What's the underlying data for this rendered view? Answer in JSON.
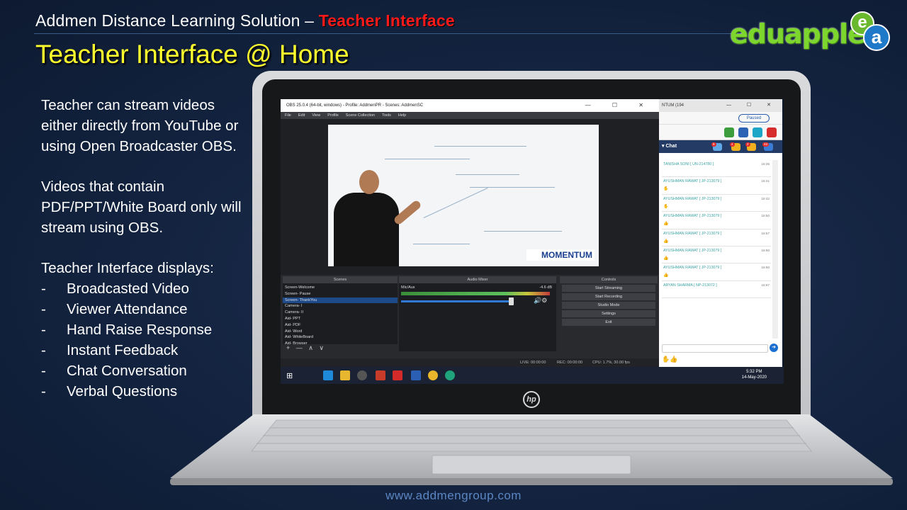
{
  "header": {
    "subtitle_main": "Addmen Distance Learning Solution – ",
    "subtitle_accent": "Teacher Interface",
    "title": "Teacher Interface @ Home",
    "logo_text": "eduapplet",
    "logo_mark_e": "e",
    "logo_mark_a": "a"
  },
  "content": {
    "para1": "Teacher can stream videos either directly from YouTube or using Open Broadcaster OBS.",
    "para2": "Videos that contain PDF/PPT/White Board only will stream using OBS.",
    "list_heading": "Teacher Interface displays:",
    "bullets": [
      "Broadcasted Video",
      "Viewer Attendance",
      "Hand Raise Response",
      "Instant Feedback",
      "Chat Conversation",
      "Verbal Questions"
    ],
    "bullet_marker": "-"
  },
  "footer": {
    "url": "www.addmengroup.com"
  },
  "laptop": {
    "brand": "hp"
  },
  "obs": {
    "title": "OBS 25.0.4 (64-bit, windows) - Profile: AddmenPR - Scenes: AddmenSC",
    "window_controls": "— ☐ ✕",
    "menu": [
      "File",
      "Edit",
      "View",
      "Profile",
      "Scene Collection",
      "Tools",
      "Help"
    ],
    "watermark": "MOMENTUM",
    "docks": {
      "scenes": "Scenes",
      "mixer": "Audio Mixer",
      "controls": "Controls"
    },
    "scenes": [
      "Screen-Welcome",
      "Screen- Pause",
      "Screen- ThankYou",
      "Camera- I",
      "Camera- II",
      "Aid- PPT",
      "Aid- PDF",
      "Aid- Word",
      "Aid- WhiteBoard",
      "Aid- Browser"
    ],
    "active_scene_index": 2,
    "scene_tools": "+ — ∧ ∨",
    "mixer": {
      "source": "Mic/Aux",
      "db": "-4.6 dB",
      "volume_fraction": 0.86
    },
    "controls": [
      "Start Streaming",
      "Start Recording",
      "Studio Mode",
      "Settings",
      "Exit"
    ],
    "status": {
      "live": "LIVE: 00:00:00",
      "rec": "REC: 00:00:00",
      "cpu": "CPU: 1.7%, 30.00 fps"
    }
  },
  "browser": {
    "tab_title": "NTUM (194",
    "window_controls": "— ☐ ✕",
    "paused_label": "Paused",
    "chat_title": "Chat",
    "badges": [
      "8",
      "4",
      "2",
      "43"
    ],
    "messages": [
      {
        "name": "TANISHA SONI [ UN-214780 ]",
        "time": "16:36",
        "emoji": ""
      },
      {
        "name": "AYUSHMAN RAWAT [ JP-213079 ]",
        "time": "16:41",
        "emoji": "✋"
      },
      {
        "name": "AYUSHMAN RAWAT [ JP-213079 ]",
        "time": "16:42",
        "emoji": "✋"
      },
      {
        "name": "AYUSHMAN RAWAT [ JP-213079 ]",
        "time": "16:50",
        "emoji": "👍"
      },
      {
        "name": "AYUSHMAN RAWAT [ JP-213079 ]",
        "time": "16:57",
        "emoji": "👍"
      },
      {
        "name": "AYUSHMAN RAWAT [ JP-213079 ]",
        "time": "16:60",
        "emoji": "👍"
      },
      {
        "name": "AYUSHMAN RAWAT [ JP-213079 ]",
        "time": "16:60",
        "emoji": "👍"
      },
      {
        "name": "ARYAN SHARMA [ NP-213072 ]",
        "time": "16:67",
        "emoji": ""
      }
    ],
    "send_icon": "➜",
    "reactions": "✋👍"
  },
  "taskbar": {
    "start": "⊞",
    "time": "5:32 PM",
    "date": "14-May-2020"
  }
}
